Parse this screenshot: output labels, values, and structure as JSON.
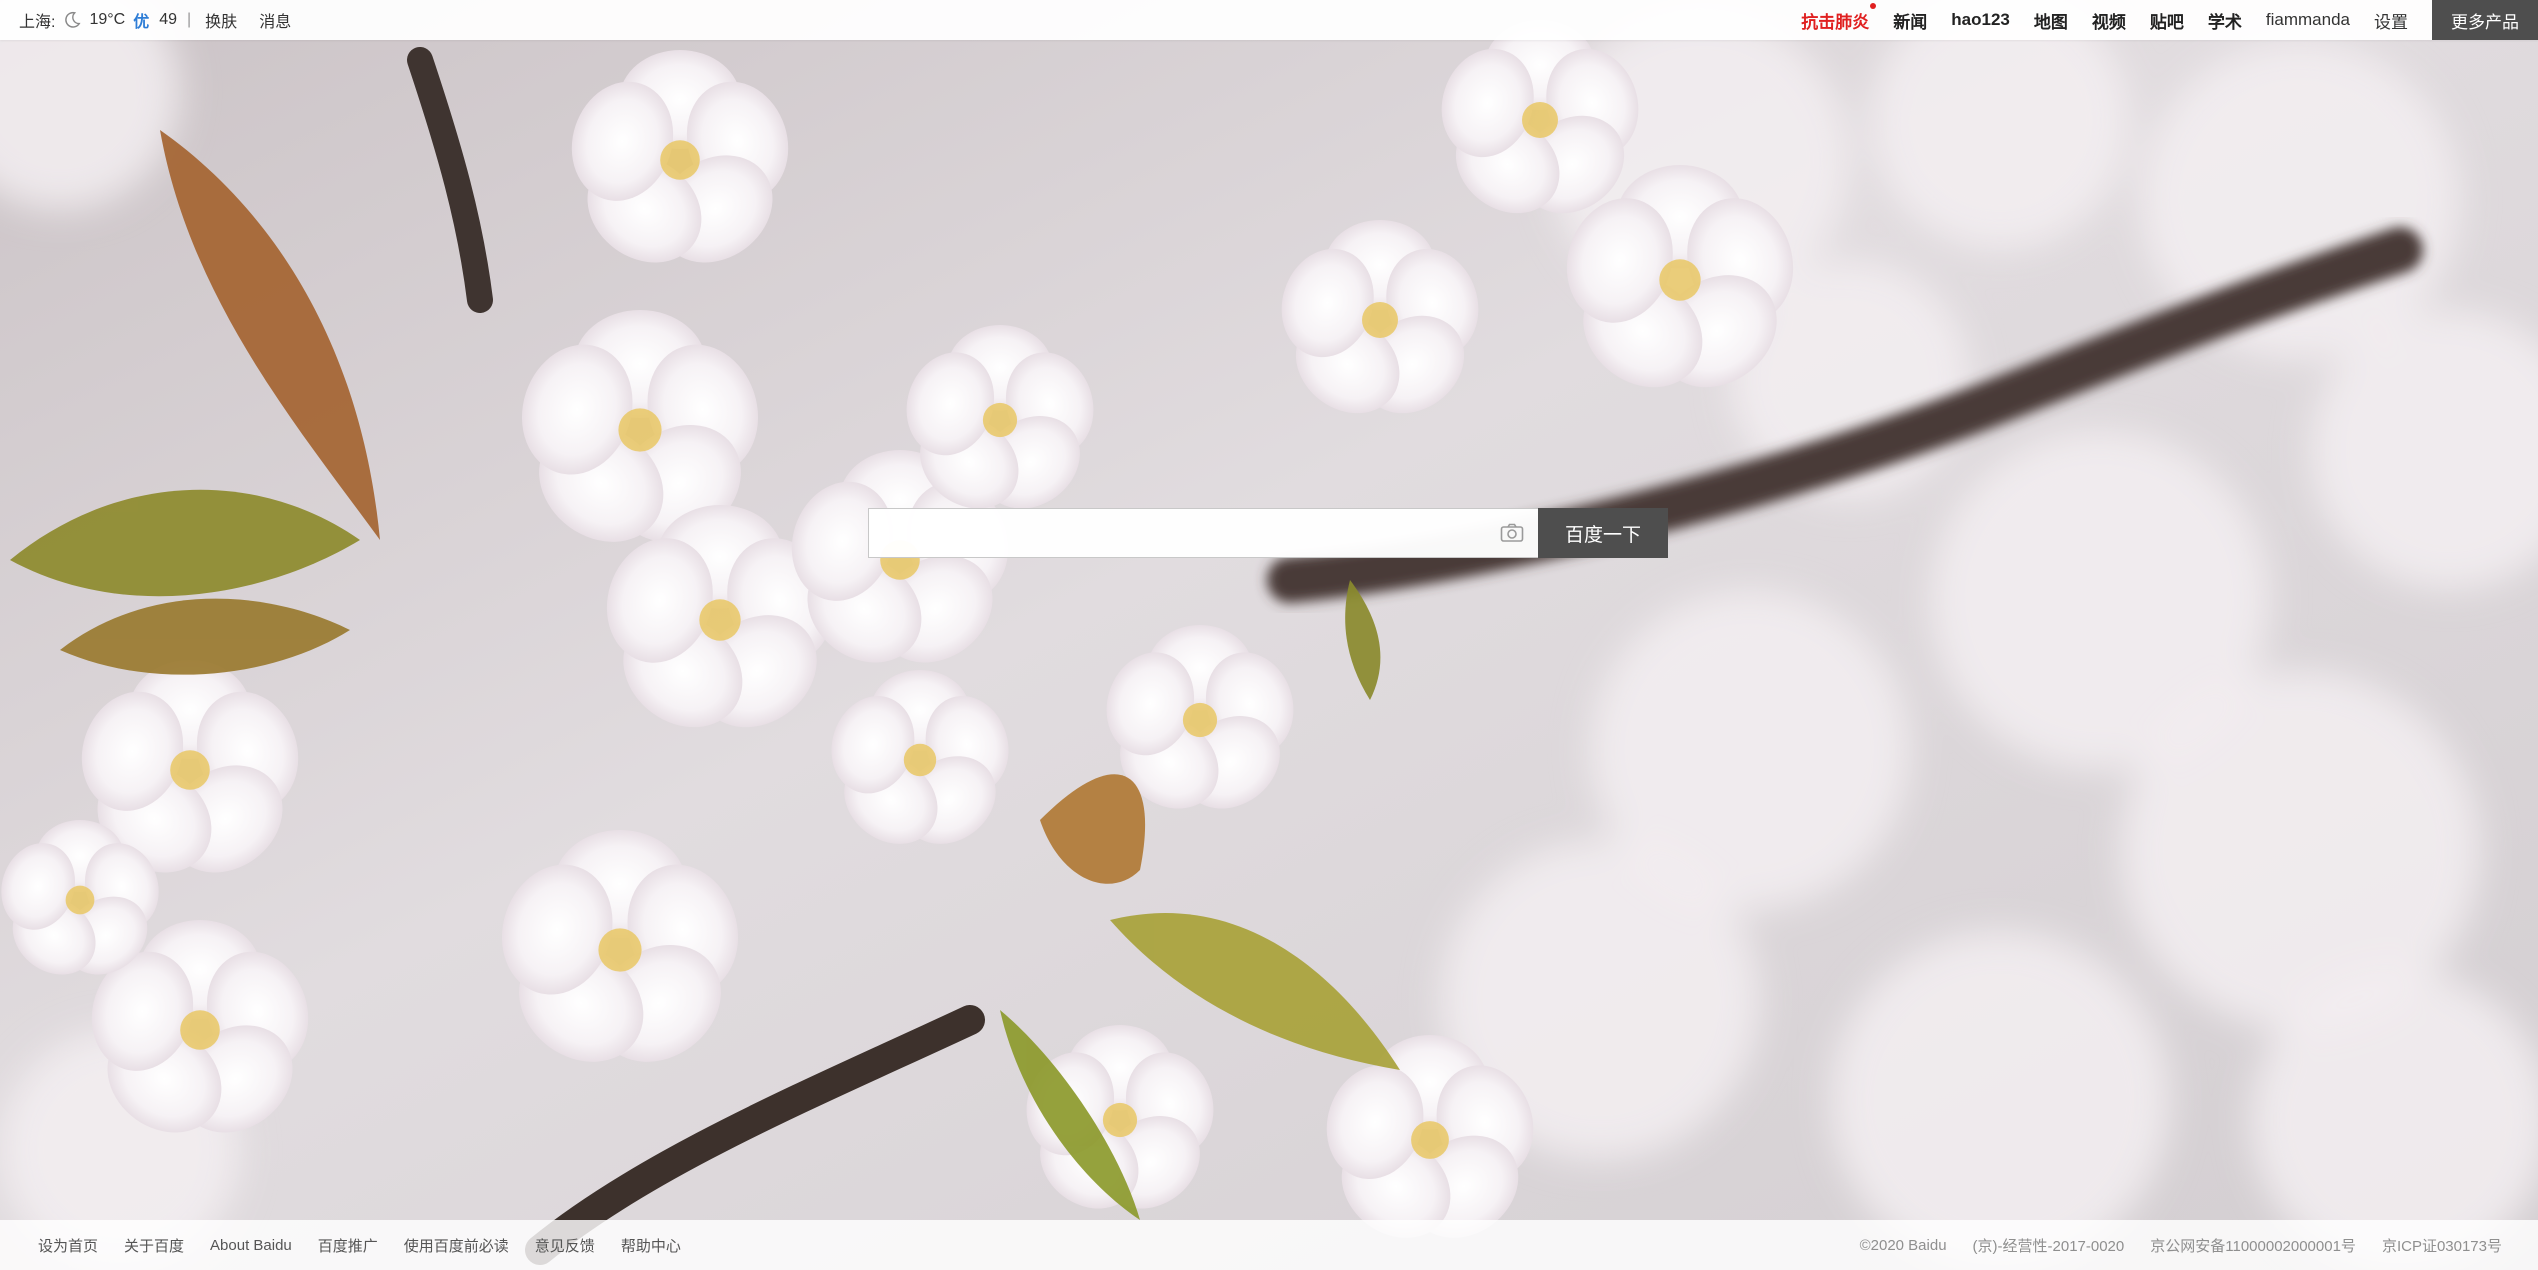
{
  "weather": {
    "city": "上海:",
    "icon": "moon-icon",
    "temperature": "19°C",
    "aqi_label": "优",
    "aqi_value": "49",
    "separator": "|"
  },
  "top_left_links": {
    "skin": "换肤",
    "messages": "消息"
  },
  "top_nav": {
    "items": [
      {
        "label": "抗击肺炎",
        "highlight": true
      },
      {
        "label": "新闻"
      },
      {
        "label": "hao123"
      },
      {
        "label": "地图"
      },
      {
        "label": "视频"
      },
      {
        "label": "贴吧"
      },
      {
        "label": "学术"
      }
    ],
    "username": "fiammanda",
    "settings": "设置",
    "more": "更多产品"
  },
  "search": {
    "value": "",
    "placeholder": "",
    "camera_icon": "camera-icon",
    "button": "百度一下"
  },
  "footer": {
    "left_links": [
      "设为首页",
      "关于百度",
      "About Baidu",
      "百度推广",
      "使用百度前必读",
      "意见反馈",
      "帮助中心"
    ],
    "right_text": [
      "©2020 Baidu",
      "(京)-经营性-2017-0020",
      "京公网安备11000002000001号",
      "京ICP证030173号"
    ]
  },
  "colors": {
    "accent_dark": "#4e4e4e",
    "highlight_red": "#e02020",
    "aqi_blue": "#2e7dd6"
  }
}
